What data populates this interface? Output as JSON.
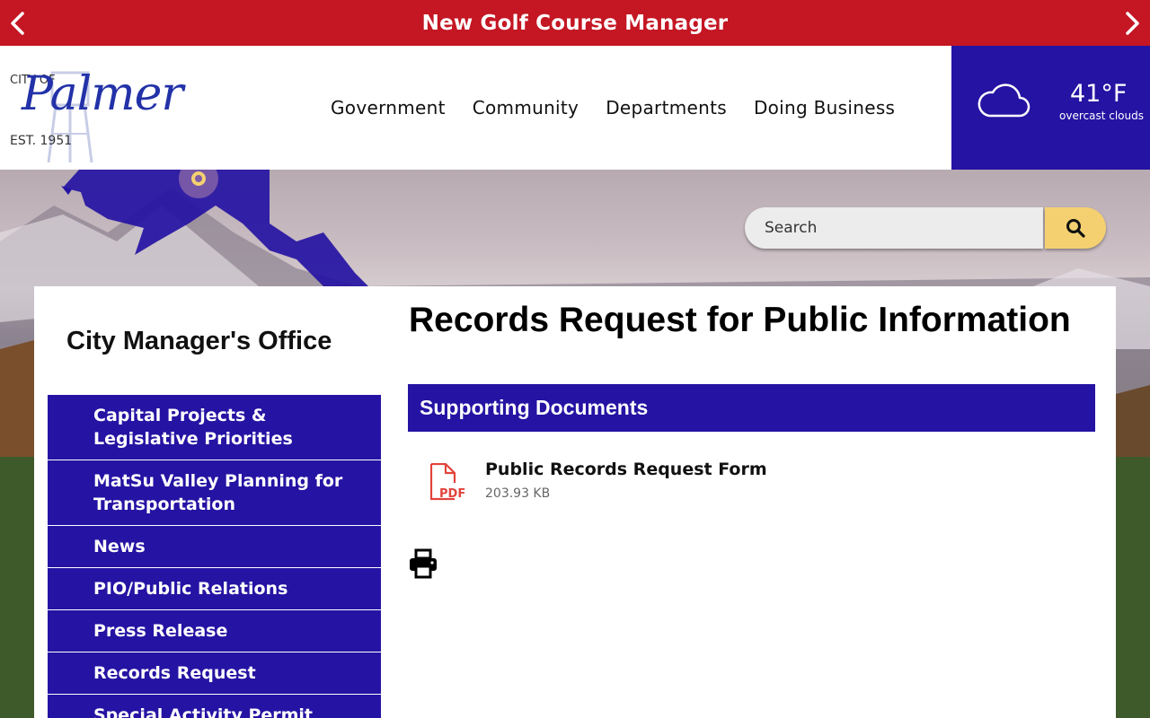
{
  "alert": {
    "text": "New Golf Course Manager",
    "prev_icon": "chevron-left-icon",
    "next_icon": "chevron-right-icon"
  },
  "logo": {
    "city_of": "CITY OF",
    "name": "Palmer",
    "est": "EST. 1951"
  },
  "nav": {
    "items": [
      "Government",
      "Community",
      "Departments",
      "Doing Business"
    ]
  },
  "weather": {
    "icon": "cloud-icon",
    "temp": "41°F",
    "condition": "overcast clouds"
  },
  "search": {
    "placeholder": "Search",
    "icon": "search-icon"
  },
  "sidebar": {
    "title": "City Manager's Office",
    "items": [
      "Capital Projects & Legislative Priorities",
      "MatSu Valley Planning for Transportation",
      "News",
      "PIO/Public Relations",
      "Press Release",
      "Records Request",
      "Special Activity Permit"
    ]
  },
  "main": {
    "title": "Records Request for Public Information",
    "docs_heading": "Supporting Documents",
    "documents": [
      {
        "name": "Public Records Request Form",
        "size": "203.93 KB",
        "icon": "pdf-icon",
        "icon_label": "PDF"
      }
    ],
    "print_icon": "print-icon"
  },
  "colors": {
    "alert_red": "#c41623",
    "brand_blue": "#2513a3",
    "search_button": "#f4d071",
    "pdf_red": "#e2433b"
  }
}
